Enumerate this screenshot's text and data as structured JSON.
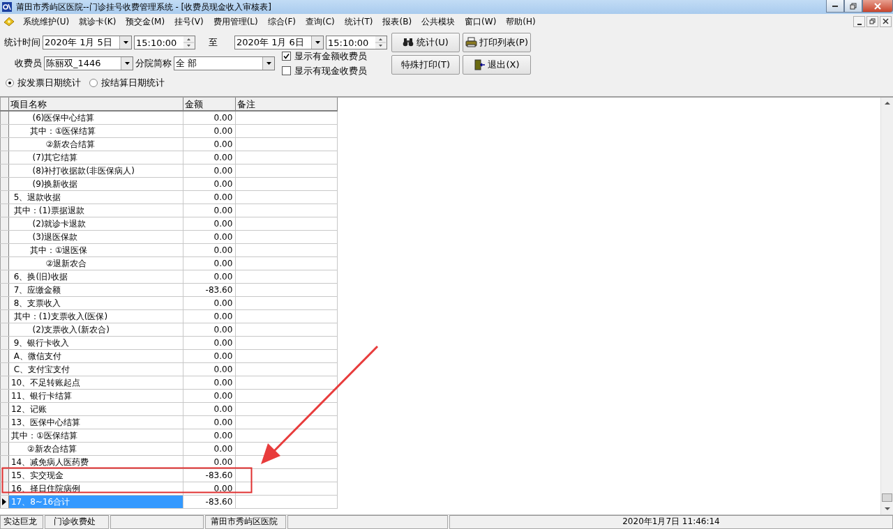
{
  "window": {
    "title": "莆田市秀屿区医院--门诊挂号收费管理系统 - [收费员现金收入审核表]"
  },
  "menu": [
    {
      "label": "系统维护(U)"
    },
    {
      "label": "就诊卡(K)"
    },
    {
      "label": "预交金(M)"
    },
    {
      "label": "挂号(V)"
    },
    {
      "label": "费用管理(L)"
    },
    {
      "label": "综合(F)"
    },
    {
      "label": "查询(C)"
    },
    {
      "label": "统计(T)"
    },
    {
      "label": "报表(B)"
    },
    {
      "label": "公共模块"
    },
    {
      "label": "窗口(W)"
    },
    {
      "label": "帮助(H)"
    }
  ],
  "form": {
    "time_label": "统计时间",
    "start_date": "2020年 1月 5日",
    "start_time": "15:10:00",
    "to_label": "至",
    "end_date": "2020年 1月 6日",
    "end_time": "15:10:00",
    "cashier_label": "收费员",
    "cashier": "陈丽双_1446",
    "branch_label": "分院简称",
    "branch": "全 部",
    "checkboxes": [
      {
        "label": "显示有金额收费员",
        "checked": true
      },
      {
        "label": "显示有现金收费员",
        "checked": false
      }
    ],
    "radios": [
      {
        "label": "按发票日期统计",
        "selected": true
      },
      {
        "label": "按结算日期统计",
        "selected": false
      }
    ],
    "buttons": [
      {
        "label": "统计(U)",
        "kind": "binoculars"
      },
      {
        "label": "打印列表(P)",
        "kind": "printer"
      },
      {
        "label": "特殊打印(T)",
        "kind": "plain"
      },
      {
        "label": "退出(X)",
        "kind": "exit"
      }
    ]
  },
  "table": {
    "columns": [
      "项目名称",
      "金额",
      "备注"
    ],
    "rows": [
      {
        "name": "        (6)医保中心结算",
        "amount": "0.00",
        "selected": false
      },
      {
        "name": "       其中：①医保结算",
        "amount": "0.00",
        "selected": false
      },
      {
        "name": "             ②新农合结算",
        "amount": "0.00",
        "selected": false
      },
      {
        "name": "        (7)其它结算",
        "amount": "0.00",
        "selected": false
      },
      {
        "name": "        (8)补打收据款(非医保病人)",
        "amount": "0.00",
        "selected": false
      },
      {
        "name": "        (9)换新收据",
        "amount": "0.00",
        "selected": false
      },
      {
        "name": " 5、退款收据",
        "amount": "0.00",
        "selected": false
      },
      {
        "name": " 其中：(1)票据退款",
        "amount": "0.00",
        "selected": false
      },
      {
        "name": "        (2)就诊卡退款",
        "amount": "0.00",
        "selected": false
      },
      {
        "name": "        (3)退医保款",
        "amount": "0.00",
        "selected": false
      },
      {
        "name": "       其中：①退医保",
        "amount": "0.00",
        "selected": false
      },
      {
        "name": "             ②退新农合",
        "amount": "0.00",
        "selected": false
      },
      {
        "name": " 6、换(旧)收据",
        "amount": "0.00",
        "selected": false
      },
      {
        "name": " 7、应缴金额",
        "amount": "-83.60",
        "selected": false
      },
      {
        "name": " 8、支票收入",
        "amount": "0.00",
        "selected": false
      },
      {
        "name": " 其中：(1)支票收入(医保)",
        "amount": "0.00",
        "selected": false
      },
      {
        "name": "        (2)支票收入(新农合)",
        "amount": "0.00",
        "selected": false
      },
      {
        "name": " 9、银行卡收入",
        "amount": "0.00",
        "selected": false
      },
      {
        "name": " A、微信支付",
        "amount": "0.00",
        "selected": false
      },
      {
        "name": " C、支付宝支付",
        "amount": "0.00",
        "selected": false
      },
      {
        "name": "10、不足转账起点",
        "amount": "0.00",
        "selected": false
      },
      {
        "name": "11、银行卡结算",
        "amount": "0.00",
        "selected": false
      },
      {
        "name": "12、记账",
        "amount": "0.00",
        "selected": false
      },
      {
        "name": "13、医保中心结算",
        "amount": "0.00",
        "selected": false
      },
      {
        "name": "其中：①医保结算",
        "amount": "0.00",
        "selected": false
      },
      {
        "name": "      ②新农合结算",
        "amount": "0.00",
        "selected": false
      },
      {
        "name": "14、减免病人医药费",
        "amount": "0.00",
        "selected": false
      },
      {
        "name": "15、实交现金",
        "amount": "-83.60",
        "selected": false
      },
      {
        "name": "16、择日住院病例",
        "amount": "0.00",
        "selected": false
      },
      {
        "name": "17、8~16合计",
        "amount": "-83.60",
        "selected": true
      }
    ]
  },
  "status_bar": [
    {
      "kind": "text",
      "text": "实达巨龙"
    },
    {
      "kind": "text",
      "text": "门诊收费处"
    },
    {
      "kind": "blank"
    },
    {
      "kind": "text",
      "text": "莆田市秀屿区医院"
    },
    {
      "kind": "blank"
    },
    {
      "kind": "wide",
      "text": "2020年1月7日 11:46:14"
    }
  ]
}
